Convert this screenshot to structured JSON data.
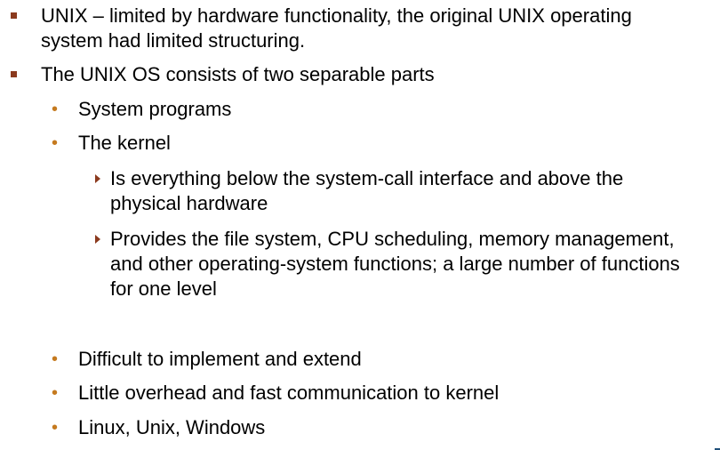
{
  "slide": {
    "bullets": [
      {
        "text": "UNIX – limited by hardware functionality, the original UNIX operating system had limited structuring."
      },
      {
        "text": "The UNIX OS consists of two separable parts"
      }
    ],
    "sub_top": [
      {
        "text": "System programs"
      },
      {
        "text": "The kernel"
      }
    ],
    "kernel_points": [
      {
        "text": "Is everything below the system-call interface and above the physical hardware"
      },
      {
        "text": "Provides the file system, CPU scheduling, memory management, and other operating-system functions; a large number of functions for one level"
      }
    ],
    "sub_bottom": [
      {
        "text": "Difficult to implement and extend"
      },
      {
        "text": "Little overhead and fast communication to kernel"
      },
      {
        "text": "Linux, Unix, Windows"
      }
    ]
  }
}
